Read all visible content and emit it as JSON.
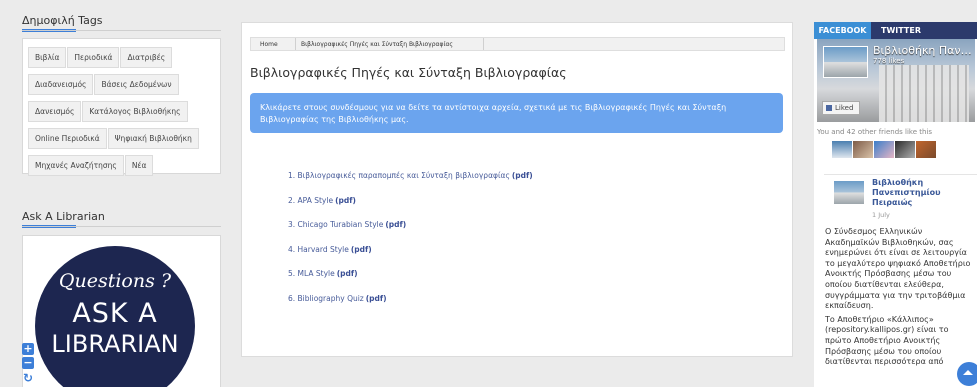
{
  "tags_widget": {
    "title": "Δημοφιλή Tags",
    "tags": [
      "Βιβλία",
      "Περιοδικά",
      "Διατριβές",
      "Διαδανεισμός",
      "Βάσεις Δεδομένων",
      "Δανεισμός",
      "Κατάλογος Βιβλιοθήκης",
      "Online Περιοδικά",
      "Ψηφιακή Βιβλιοθήκη",
      "Μηχανές Αναζήτησης",
      "Νέα"
    ]
  },
  "librarian_widget": {
    "title": "Ask A Librarian",
    "image_text": {
      "line1": "Questions ?",
      "line2": "ASK A",
      "line3": "LIBRARIAN"
    }
  },
  "map_controls": {
    "zoom_in": "+",
    "zoom_out": "−",
    "reset": "↻"
  },
  "breadcrumb": {
    "home": "Home",
    "current": "Βιβλιογραφικές Πηγές και Σύνταξη Βιβλιογραφίας"
  },
  "page": {
    "title": "Βιβλιογραφικές Πηγές και Σύνταξη Βιβλιογραφίας",
    "info": "Κλικάρετε στους συνδέσμους για να δείτε τα αντίστοιχα αρχεία, σχετικά με τις Βιβλιογραφικές Πηγές και Σύνταξη Βιβλιογραφίας της Βιβλιοθήκης μας.",
    "links": [
      {
        "text": "1. Βιβλιογραφικές παραπομπές και Σύνταξη βιβλιογραφίας",
        "pdf": "(pdf)"
      },
      {
        "text": "2. APA Style",
        "pdf": "(pdf)"
      },
      {
        "text": "3. Chicago Turabian Style",
        "pdf": "(pdf)"
      },
      {
        "text": "4. Harvard Style",
        "pdf": "(pdf)"
      },
      {
        "text": "5. MLA Style",
        "pdf": "(pdf)"
      },
      {
        "text": "6. Bibliography Quiz",
        "pdf": "(pdf)"
      }
    ]
  },
  "social": {
    "tabs": [
      "FACEBOOK",
      "TWITTER"
    ],
    "page_name": "Βιβλιοθήκη Παν…",
    "likes": "778 likes",
    "liked_button": "Liked",
    "friends_text": "You and 42 other friends like this",
    "post": {
      "author": "Βιβλιοθήκη Πανεπιστημίου Πειραιώς",
      "date": "1 July",
      "paragraphs": [
        "Ο Σύνδεσμος Ελληνικών Ακαδημαϊκών Βιβλιοθηκών, σας ενημερώνει ότι είναι σε λειτουργία το μεγαλύτερο ψηφιακό Αποθετήριο Ανοικτής Πρόσβασης μέσω του οποίου διατίθενται ελεύθερα, συγγράμματα για την τριτοβάθμια εκπαίδευση.",
        "Το Αποθετήριο «Κάλλιπος» (repository.kallipos.gr) είναι το πρώτο Αποθετήριο Ανοικτής Πρόσβασης μέσω του οποίου διατίθενται περισσότερα από"
      ]
    }
  },
  "colors": {
    "accent": "#3d7fd8",
    "info_box": "#6ba4ee",
    "link": "#475b99",
    "fb_tab": "#3b8fd5",
    "tab_bar": "#2c3a6c"
  }
}
